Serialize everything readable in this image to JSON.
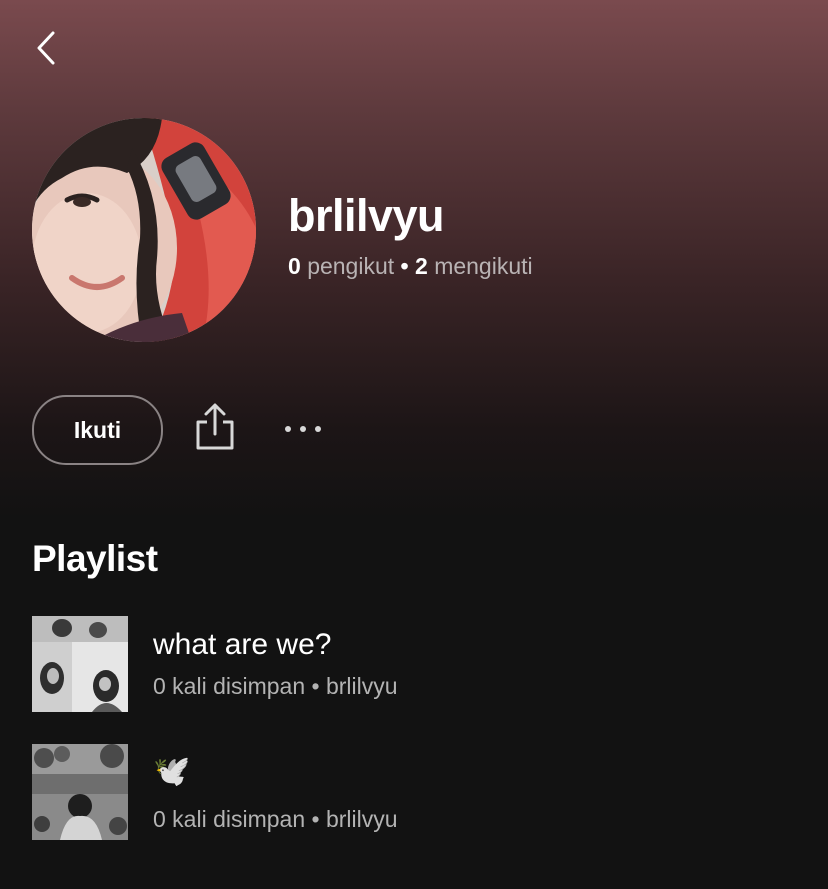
{
  "header": {
    "back_icon": "chevron-left-icon"
  },
  "profile": {
    "name": "brlilvyu",
    "followers_count": "0",
    "followers_label": "pengikut",
    "separator": "•",
    "following_count": "2",
    "following_label": "mengikuti",
    "avatar_alt": "profile photo"
  },
  "actions": {
    "follow_label": "Ikuti",
    "share_icon": "share-icon",
    "more_icon": "more-options-icon"
  },
  "playlists": {
    "section_title": "Playlist",
    "items": [
      {
        "title": "what are we?",
        "subtitle": "0 kali disimpan • brlilvyu"
      },
      {
        "title": "🕊️",
        "subtitle": "0 kali disimpan • brlilvyu"
      }
    ]
  },
  "colors": {
    "background": "#121212",
    "header_gradient_top": "#7a4a4e",
    "text_primary": "#ffffff",
    "text_secondary": "#b3b3b3"
  }
}
